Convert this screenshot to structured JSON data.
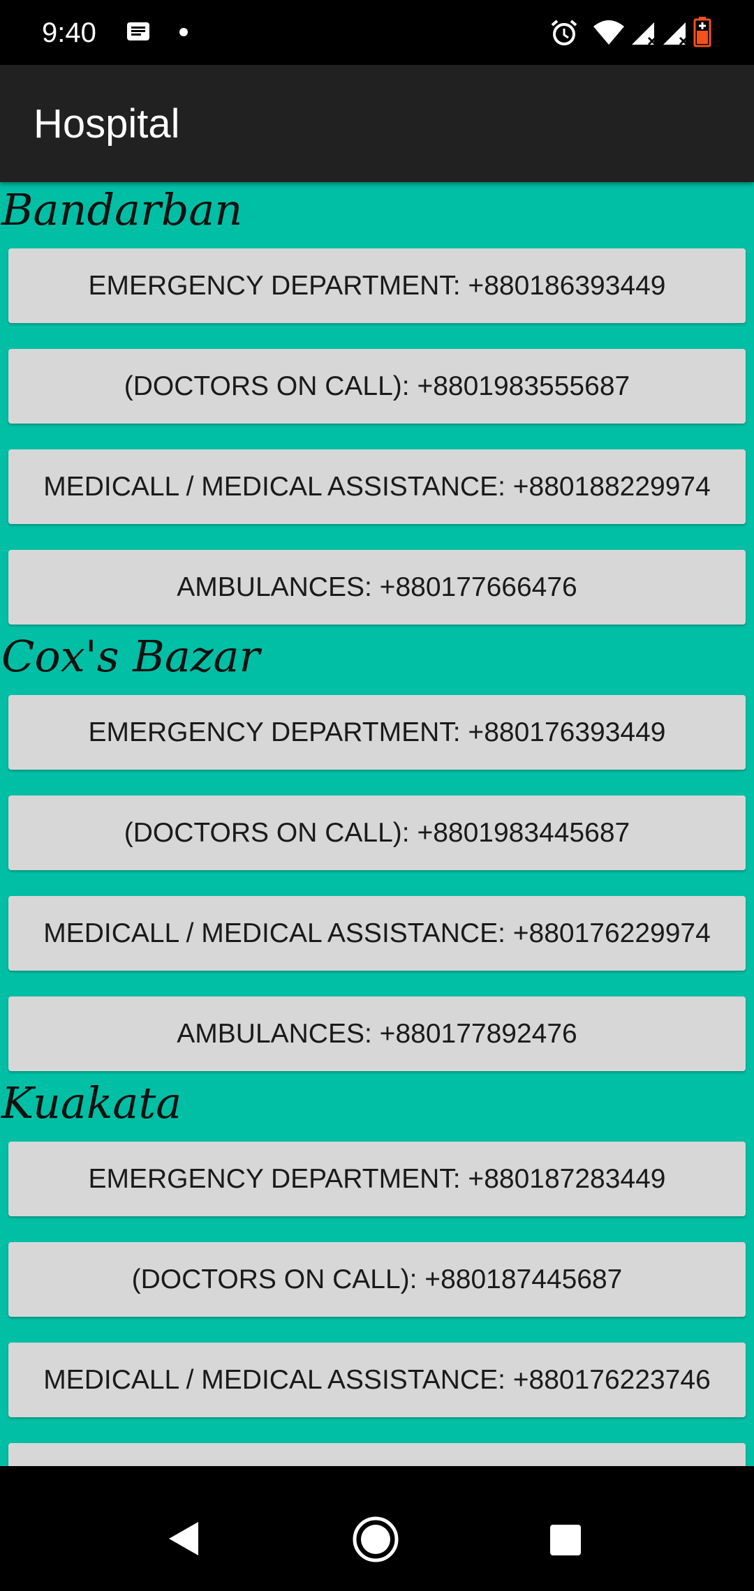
{
  "status_bar": {
    "time": "9:40",
    "icons": [
      "message-icon",
      "dot-icon",
      "alarm-icon",
      "wifi-icon",
      "signal-icon",
      "signal-icon-2",
      "battery-icon"
    ]
  },
  "app_bar": {
    "title": "Hospital"
  },
  "sections": [
    {
      "city": "Bandarban",
      "contacts": [
        "EMERGENCY DEPARTMENT: +880186393449",
        "(DOCTORS ON CALL): +8801983555687",
        "MEDICALL / MEDICAL ASSISTANCE: +880188229974",
        "AMBULANCES: +880177666476"
      ]
    },
    {
      "city": "Cox's Bazar",
      "contacts": [
        "EMERGENCY DEPARTMENT: +880176393449",
        "(DOCTORS ON CALL): +8801983445687",
        "MEDICALL / MEDICAL ASSISTANCE: +880176229974",
        "AMBULANCES: +880177892476"
      ]
    },
    {
      "city": "Kuakata",
      "contacts": [
        "EMERGENCY DEPARTMENT: +880187283449",
        "(DOCTORS ON CALL): +880187445687",
        "MEDICALL / MEDICAL ASSISTANCE: +880176223746"
      ]
    }
  ],
  "colors": {
    "content_background": "#00bfa5",
    "app_bar": "#212121",
    "button": "#d7d7d7"
  }
}
